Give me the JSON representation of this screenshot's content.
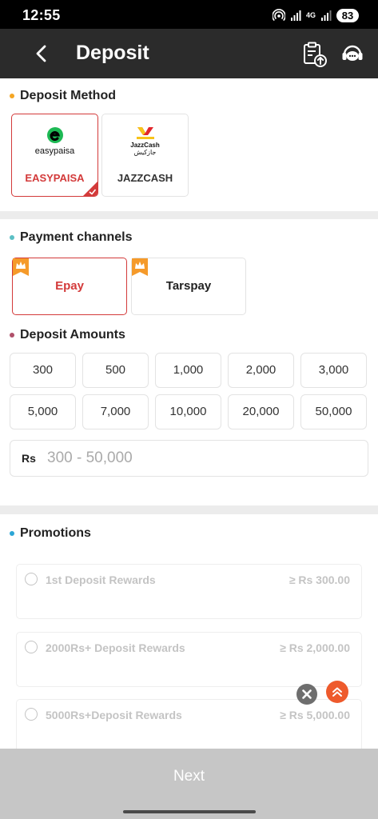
{
  "status_bar": {
    "time": "12:55",
    "network": "4G",
    "battery": "83"
  },
  "header": {
    "title": "Deposit",
    "back_icon": "chevron-left-icon",
    "records_icon": "clipboard-upload-icon",
    "service_icon": "customer-service-icon"
  },
  "deposit_method": {
    "title": "Deposit Method",
    "accent": "#f5a623",
    "methods": [
      {
        "logo_text": "easypaisa",
        "label": "EASYPAISA",
        "selected": true
      },
      {
        "logo_text": "JazzCash",
        "logo_subtext": "جازکیش",
        "label": "JAZZCASH",
        "selected": false
      }
    ]
  },
  "payment_channels": {
    "title": "Payment channels",
    "accent": "#5bbfc4",
    "channels": [
      {
        "label": "Epay",
        "selected": true
      },
      {
        "label": "Tarspay",
        "selected": false
      }
    ]
  },
  "deposit_amounts": {
    "title": "Deposit Amounts",
    "accent": "#b0506a",
    "options": [
      "300",
      "500",
      "1,000",
      "2,000",
      "3,000",
      "5,000",
      "7,000",
      "10,000",
      "20,000",
      "50,000"
    ],
    "currency": "Rs",
    "placeholder": "300 - 50,000"
  },
  "promotions": {
    "title": "Promotions",
    "accent": "#2ca6d6",
    "items": [
      {
        "name": "1st Deposit Rewards",
        "amount": "≥ Rs 300.00"
      },
      {
        "name": "2000Rs+ Deposit Rewards",
        "amount": "≥ Rs 2,000.00"
      },
      {
        "name": "5000Rs+Deposit Rewards",
        "amount": "≥ Rs 5,000.00"
      }
    ]
  },
  "footer": {
    "next_label": "Next"
  },
  "colors": {
    "selected": "#d33a3a",
    "header_bg": "#2b2b2b",
    "next_bg": "#c6c6c6",
    "scroll_top_bg": "#ee5a2c"
  }
}
